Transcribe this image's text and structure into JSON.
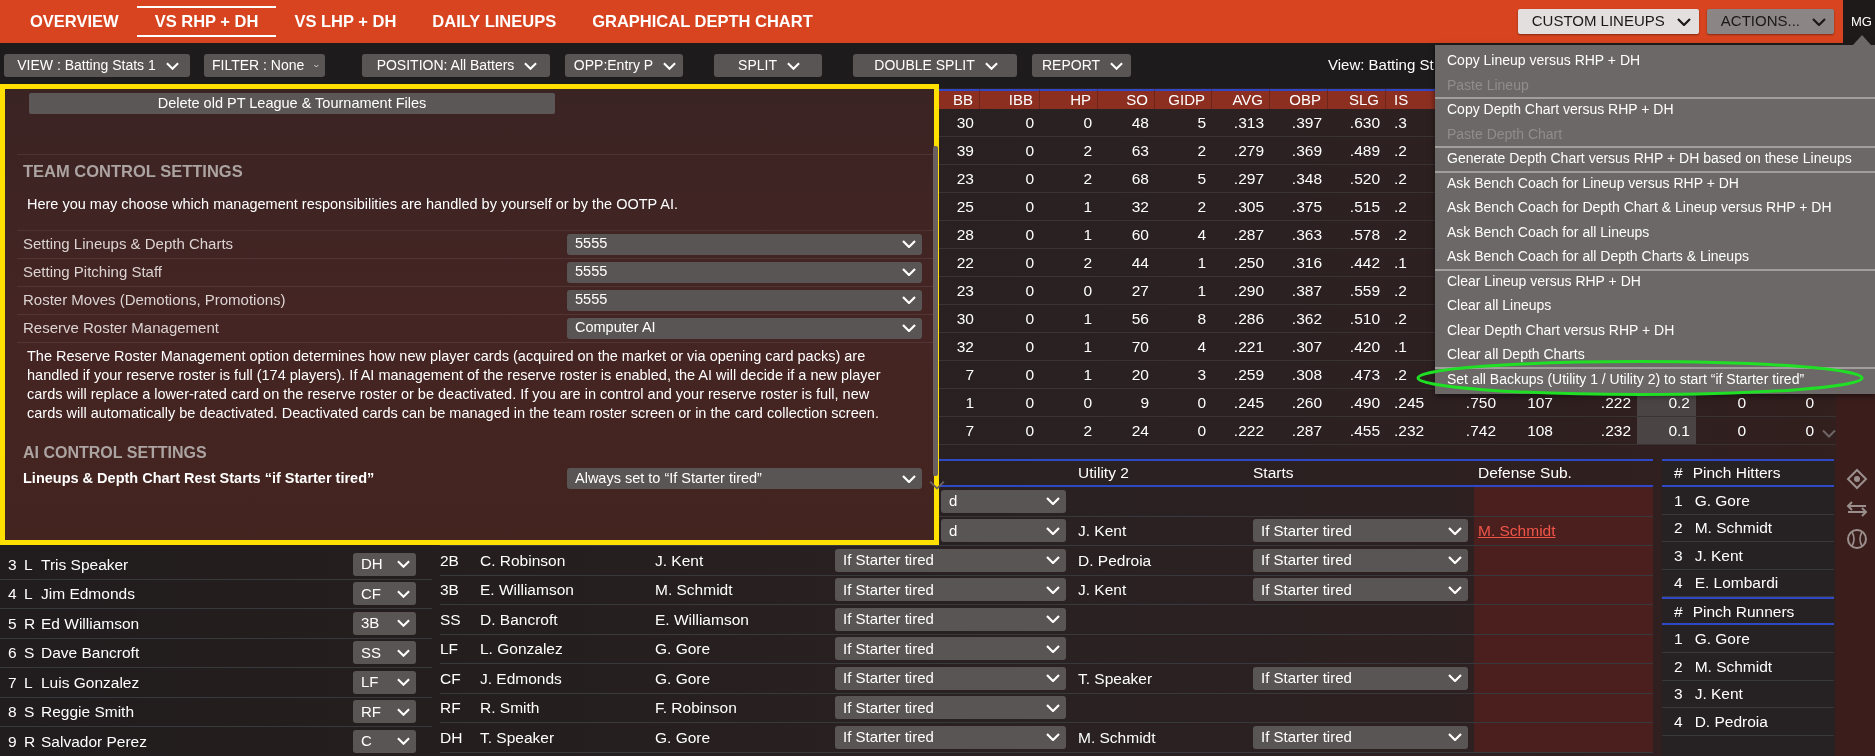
{
  "top_tabs": [
    {
      "label": "OVERVIEW",
      "selected": false
    },
    {
      "label": "VS RHP + DH",
      "selected": true
    },
    {
      "label": "VS LHP + DH",
      "selected": false
    },
    {
      "label": "DAILY LINEUPS",
      "selected": false
    },
    {
      "label": "GRAPHICAL DEPTH CHART",
      "selected": false
    }
  ],
  "header_buttons": [
    {
      "label": "CUSTOM LINEUPS",
      "kind": "light"
    },
    {
      "label": "ACTIONS...",
      "kind": "dark"
    }
  ],
  "manager_badge": "MG",
  "toolbar": {
    "dropdowns": [
      "VIEW : Batting Stats 1",
      "FILTER : None",
      "POSITION: All Batters",
      "OPP:Entry P",
      "SPLIT",
      "DOUBLE SPLIT",
      "REPORT"
    ],
    "view_label": "View: Batting St"
  },
  "stats_table": {
    "columns": [
      "BB",
      "IBB",
      "HP",
      "SO",
      "GIDP",
      "AVG",
      "OBP",
      "SLG",
      "IS"
    ],
    "rows": [
      [
        "30",
        "0",
        "0",
        "48",
        "5",
        ".313",
        ".397",
        ".630",
        ".3"
      ],
      [
        "39",
        "0",
        "2",
        "63",
        "2",
        ".279",
        ".369",
        ".489",
        ".2"
      ],
      [
        "23",
        "0",
        "2",
        "68",
        "5",
        ".297",
        ".348",
        ".520",
        ".2"
      ],
      [
        "25",
        "0",
        "1",
        "32",
        "2",
        ".305",
        ".375",
        ".515",
        ".2"
      ],
      [
        "28",
        "0",
        "1",
        "60",
        "4",
        ".287",
        ".363",
        ".578",
        ".2"
      ],
      [
        "22",
        "0",
        "2",
        "44",
        "1",
        ".250",
        ".316",
        ".442",
        ".1"
      ],
      [
        "23",
        "0",
        "0",
        "27",
        "1",
        ".290",
        ".387",
        ".559",
        ".2"
      ],
      [
        "30",
        "0",
        "1",
        "56",
        "8",
        ".286",
        ".362",
        ".510",
        ".2"
      ],
      [
        "32",
        "0",
        "1",
        "70",
        "4",
        ".221",
        ".307",
        ".420",
        ".1"
      ],
      [
        "7",
        "0",
        "1",
        "20",
        "3",
        ".259",
        ".308",
        ".473",
        ".2"
      ],
      [
        "1",
        "0",
        "0",
        "9",
        "0",
        ".245",
        ".260",
        ".490",
        ".245",
        ".750",
        "107",
        ".222",
        {
          "text": "0.2",
          "highlighted": true
        },
        "0",
        "0"
      ],
      [
        "7",
        "0",
        "2",
        "24",
        "0",
        ".222",
        ".287",
        ".455",
        ".232",
        ".742",
        "108",
        ".232",
        {
          "text": "0.1",
          "highlighted": true
        },
        "0",
        "0"
      ]
    ]
  },
  "lineup": {
    "rows": [
      {
        "order": "3",
        "bats": "L",
        "name": "Tris Speaker",
        "position": "DH"
      },
      {
        "order": "4",
        "bats": "L",
        "name": "Jim Edmonds",
        "position": "CF"
      },
      {
        "order": "5",
        "bats": "R",
        "name": "Ed Williamson",
        "position": "3B"
      },
      {
        "order": "6",
        "bats": "S",
        "name": "Dave Bancroft",
        "position": "SS"
      },
      {
        "order": "7",
        "bats": "L",
        "name": "Luis Gonzalez",
        "position": "LF"
      },
      {
        "order": "8",
        "bats": "S",
        "name": "Reggie Smith",
        "position": "RF"
      },
      {
        "order": "9",
        "bats": "R",
        "name": "Salvador Perez",
        "position": "C"
      }
    ]
  },
  "depth_chart": {
    "columns": [
      "Utility 2",
      "Starts",
      "Defense Sub."
    ],
    "rows": [
      {
        "utility_1_starts": "d"
      },
      {
        "utility_1_starts": "d",
        "utility_2": "J. Kent",
        "utility_2_starts": "If Starter tired",
        "defense_sub": "M. Schmidt"
      },
      {
        "position": "2B",
        "starter": "C. Robinson",
        "utility_1": "J. Kent",
        "utility_1_starts": "If Starter tired",
        "utility_2": "D. Pedroia",
        "utility_2_starts": "If Starter tired"
      },
      {
        "position": "3B",
        "starter": "E. Williamson",
        "utility_1": "M. Schmidt",
        "utility_1_starts": "If Starter tired",
        "utility_2": "J. Kent",
        "utility_2_starts": "If Starter tired"
      },
      {
        "position": "SS",
        "starter": "D. Bancroft",
        "utility_1": "E. Williamson",
        "utility_1_starts": "If Starter tired"
      },
      {
        "position": "LF",
        "starter": "L. Gonzalez",
        "utility_1": "G. Gore",
        "utility_1_starts": "If Starter tired"
      },
      {
        "position": "CF",
        "starter": "J. Edmonds",
        "utility_1": "G. Gore",
        "utility_1_starts": "If Starter tired",
        "utility_2": "T. Speaker",
        "utility_2_starts": "If Starter tired"
      },
      {
        "position": "RF",
        "starter": "R. Smith",
        "utility_1": "F. Robinson",
        "utility_1_starts": "If Starter tired"
      },
      {
        "position": "DH",
        "starter": "T. Speaker",
        "utility_1": "G. Gore",
        "utility_1_starts": "If Starter tired",
        "utility_2": "M. Schmidt",
        "utility_2_starts": "If Starter tired"
      }
    ]
  },
  "bench": [
    {
      "number_label": "#",
      "title": "Pinch Hitters",
      "players": [
        {
          "number": "1",
          "name": "G. Gore"
        },
        {
          "number": "2",
          "name": "M. Schmidt"
        },
        {
          "number": "3",
          "name": "J. Kent"
        },
        {
          "number": "4",
          "name": "E. Lombardi"
        }
      ]
    },
    {
      "number_label": "#",
      "title": "Pinch Runners",
      "players": [
        {
          "number": "1",
          "name": "G. Gore"
        },
        {
          "number": "2",
          "name": "M. Schmidt"
        },
        {
          "number": "3",
          "name": "J. Kent"
        },
        {
          "number": "4",
          "name": "D. Pedroia"
        }
      ]
    }
  ],
  "settings_dialog": {
    "delete_button": "Delete old PT League & Tournament Files",
    "team_section": {
      "title": "TEAM CONTROL SETTINGS",
      "description": "Here you may choose which management responsibilities are handled by yourself or by the OOTP AI.",
      "settings": [
        {
          "label": "Setting Lineups & Depth Charts",
          "value": "5555"
        },
        {
          "label": "Setting Pitching Staff",
          "value": "5555"
        },
        {
          "label": "Roster Moves (Demotions, Promotions)",
          "value": "5555"
        },
        {
          "label": "Reserve Roster Management",
          "value": "Computer AI"
        }
      ],
      "note": "The Reserve Roster Management option determines how new player cards (acquired on the market or via opening card packs) are handled if your reserve roster is full (174 players). If AI management of the reserve roster is enabled, the AI will decide if a new player cards will replace a lower-rated card on the reserve roster or be deactivated. If you are in control and your reserve roster is full, new cards will automatically be deactivated. Deactivated cards can be managed in the team roster screen or in the card collection screen."
    },
    "ai_section": {
      "title": "AI CONTROL SETTINGS",
      "settings": [
        {
          "label": "Lineups & Depth Chart Rest Starts “if Starter tired”",
          "value": "Always set to “If Starter tired”"
        }
      ]
    }
  },
  "actions_menu": {
    "items": [
      {
        "label": "Copy Lineup versus RHP + DH",
        "disabled": false,
        "divider_above": false
      },
      {
        "label": "Paste Lineup",
        "disabled": true,
        "divider_above": false
      },
      {
        "label": "Copy Depth Chart versus RHP + DH",
        "disabled": false,
        "divider_above": true
      },
      {
        "label": "Paste Depth Chart",
        "disabled": true,
        "divider_above": false
      },
      {
        "label": "Generate Depth Chart versus RHP + DH based on these Lineups",
        "disabled": false,
        "divider_above": true
      },
      {
        "label": "Ask Bench Coach for Lineup versus RHP + DH",
        "disabled": false,
        "divider_above": true
      },
      {
        "label": "Ask Bench Coach for Depth Chart & Lineup versus RHP + DH",
        "disabled": false,
        "divider_above": false
      },
      {
        "label": "Ask Bench Coach for all Lineups",
        "disabled": false,
        "divider_above": false
      },
      {
        "label": "Ask Bench Coach for all Depth Charts & Lineups",
        "disabled": false,
        "divider_above": false
      },
      {
        "label": "Clear Lineup versus RHP + DH",
        "disabled": false,
        "divider_above": true
      },
      {
        "label": "Clear all Lineups",
        "disabled": false,
        "divider_above": false
      },
      {
        "label": "Clear Depth Chart versus RHP + DH",
        "disabled": false,
        "divider_above": false
      },
      {
        "label": "Clear all Depth Charts",
        "disabled": false,
        "divider_above": false
      },
      {
        "label": "Set all Backups (Utility 1 / Utility 2) to start “if Starter tired”",
        "disabled": false,
        "divider_above": true
      }
    ]
  }
}
